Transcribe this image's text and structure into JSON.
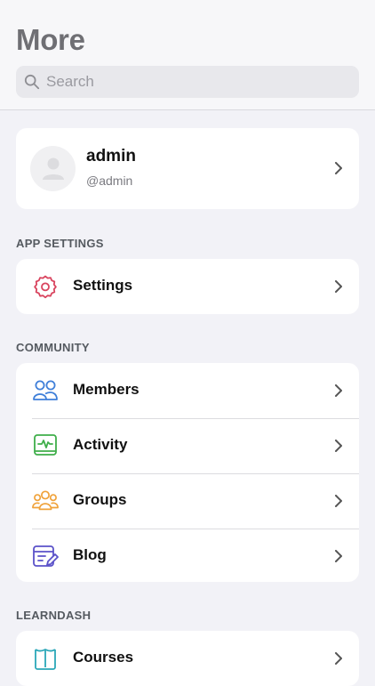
{
  "header": {
    "title": "More",
    "search_placeholder": "Search"
  },
  "profile": {
    "name": "admin",
    "handle": "@admin"
  },
  "sections": {
    "app_settings": {
      "label": "APP SETTINGS",
      "items": [
        {
          "label": "Settings",
          "icon": "gear-icon",
          "color": "#d9455f"
        }
      ]
    },
    "community": {
      "label": "COMMUNITY",
      "items": [
        {
          "label": "Members",
          "icon": "members-icon",
          "color": "#3f7fd9"
        },
        {
          "label": "Activity",
          "icon": "activity-icon",
          "color": "#3fae4a"
        },
        {
          "label": "Groups",
          "icon": "groups-icon",
          "color": "#f0a23a"
        },
        {
          "label": "Blog",
          "icon": "blog-icon",
          "color": "#5b52c9"
        }
      ]
    },
    "learndash": {
      "label": "LEARNDASH",
      "items": [
        {
          "label": "Courses",
          "icon": "courses-icon",
          "color": "#2aa7b8"
        }
      ]
    }
  }
}
